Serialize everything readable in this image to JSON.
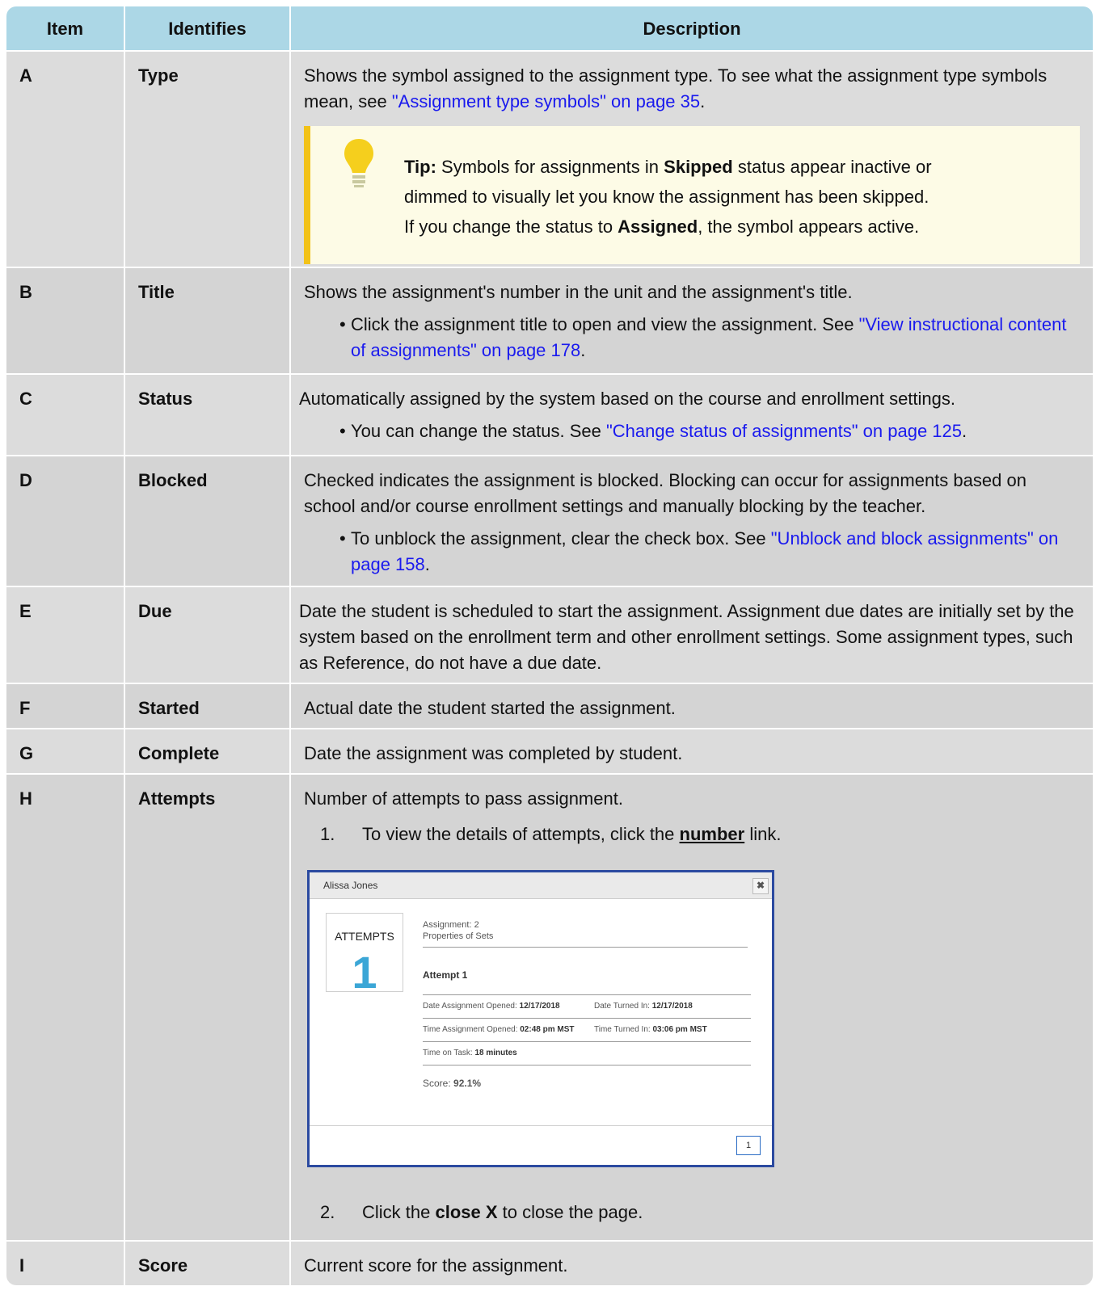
{
  "header": {
    "item": "Item",
    "identifies": "Identifies",
    "description": "Description"
  },
  "rows": {
    "a": {
      "item": "A",
      "identifies": "Type",
      "desc_text": "Shows the symbol assigned to the assignment type. To see what the assignment type symbols mean, see ",
      "desc_link": "\"Assignment type symbols\" on page 35",
      "tip": {
        "label": "Tip:",
        "t1": " Symbols for assignments in ",
        "skipped": "Skipped",
        "t2": " status appear inactive or",
        "t3": "dimmed to visually let you know the assignment has been skipped.",
        "t4": "If you change the status to ",
        "assigned": "Assigned",
        "t5": ", the symbol appears active."
      }
    },
    "b": {
      "item": "B",
      "identifies": "Title",
      "desc_text": "Shows the assignment's number in the unit and the assignment's title.",
      "bullet_text": "Click the assignment title to open and view the assignment. See ",
      "bullet_link": "\"View instructional content of assignments\" on page 178"
    },
    "c": {
      "item": "C",
      "identifies": "Status",
      "desc_text": "Automatically assigned by the system based on the course and enrollment settings.",
      "bullet_text": "You can change the status. See ",
      "bullet_link": "\"Change status of assignments\" on page 125"
    },
    "d": {
      "item": "D",
      "identifies": "Blocked",
      "desc_text": "Checked indicates the assignment is blocked. Blocking can occur for assignments based on school and/or course enrollment settings and manually blocking by the teacher.",
      "bullet_text": "To unblock the assignment, clear the check box. See ",
      "bullet_link": "\"Unblock and block assignments\" on page 158"
    },
    "e": {
      "item": "E",
      "identifies": "Due",
      "desc_text": "Date the student is scheduled to start the assignment. Assignment due dates are initially set by the system based on the enrollment term and other enrollment settings. Some assignment types, such as Reference, do not have a due date."
    },
    "f": {
      "item": "F",
      "identifies": "Started",
      "desc_text": "Actual date the student started the assignment."
    },
    "g": {
      "item": "G",
      "identifies": "Complete",
      "desc_text": "Date the assignment was completed by student."
    },
    "h": {
      "item": "H",
      "identifies": "Attempts",
      "desc_text": "Number of attempts to pass assignment.",
      "step1_num": "1.",
      "step1_a": "To view the details of attempts, click the ",
      "step1_link": "number",
      "step1_b": " link.",
      "step2_num": "2.",
      "step2_a": "Click the ",
      "step2_bold": "close X",
      "step2_b": " to close the page.",
      "modal": {
        "title": "Alissa Jones",
        "close": "✖",
        "attempts_label": "ATTEMPTS",
        "attempts_count": "1",
        "assignment_line": "Assignment: 2",
        "assignment_name": "Properties of Sets",
        "attempt_heading": "Attempt 1",
        "date_opened_label": "Date Assignment Opened:",
        "date_opened": "12/17/2018",
        "date_turned_label": "Date Turned In:",
        "date_turned": "12/17/2018",
        "time_opened_label": "Time Assignment Opened:",
        "time_opened": "02:48 pm MST",
        "time_turned_label": "Time Turned In:",
        "time_turned": "03:06 pm MST",
        "time_on_task_label": "Time on Task:",
        "time_on_task": "18 minutes",
        "score_label": "Score:",
        "score": "92.1%",
        "page": "1"
      }
    },
    "i": {
      "item": "I",
      "identifies": "Score",
      "desc_text": "Current score for the assignment."
    }
  },
  "colors": {
    "header_bg": "#acd7e6",
    "row_bg": "#dcdcdc",
    "link": "#1a1aee",
    "tip_border": "#f2c218",
    "tip_bg": "#fdfbe6",
    "modal_border": "#2b4aa0",
    "attempts_number": "#3ba6d6"
  },
  "icons": {
    "tip": "lightbulb-icon",
    "bullet": "bullet-dot-icon",
    "modal_close": "close-icon"
  }
}
